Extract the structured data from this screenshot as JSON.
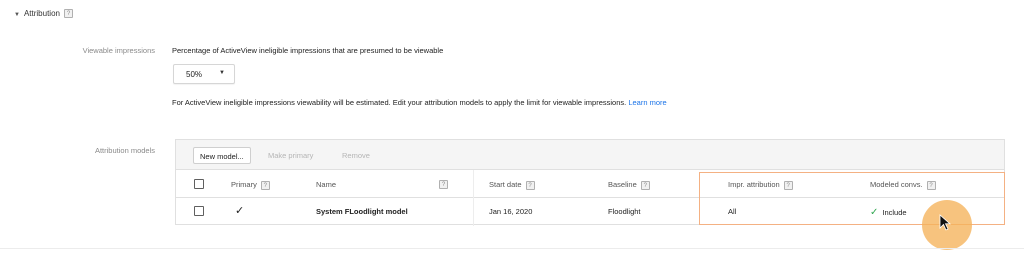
{
  "section": {
    "title": "Attribution",
    "help": "?"
  },
  "viewable": {
    "label": "Viewable impressions",
    "description": "Percentage of ActiveView ineligible impressions that are presumed to be viewable",
    "dropdown_value": "50%",
    "note": "For ActiveView ineligible impressions viewability will be estimated. Edit your attribution models to apply the limit for viewable impressions.",
    "learn_more": "Learn more"
  },
  "attribution_models": {
    "label": "Attribution models",
    "toolbar": {
      "new_model": "New model...",
      "make_primary": "Make primary",
      "remove": "Remove"
    },
    "columns": {
      "primary": "Primary",
      "name": "Name",
      "start_date": "Start date",
      "baseline": "Baseline",
      "impr_attribution": "Impr. attribution",
      "modeled_convs": "Modeled convs."
    },
    "rows": [
      {
        "primary_mark": "✓",
        "name": "System FLoodlight model",
        "start_date": "Jan 16, 2020",
        "baseline": "Floodlight",
        "impr_attribution": "All",
        "modeled_convs": "Include",
        "modeled_convs_mark": "✓"
      }
    ]
  },
  "colors": {
    "accent_link": "#1a73e8",
    "highlight": "#f4b183",
    "cursor_halo": "#f5b25a",
    "check_green": "#34a853"
  }
}
